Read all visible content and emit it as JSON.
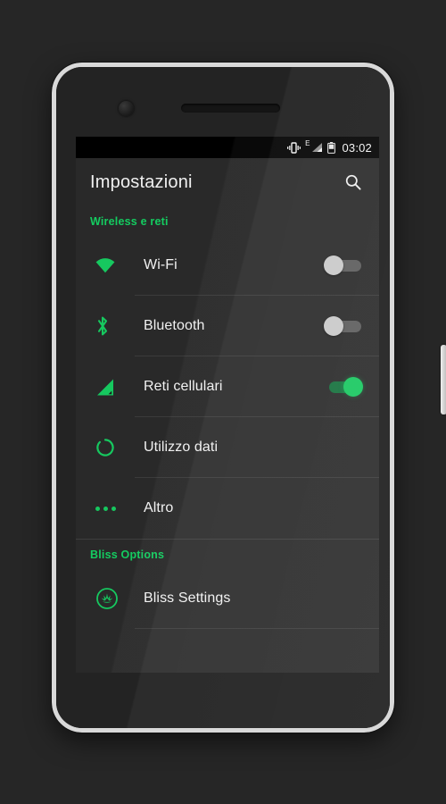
{
  "theme": {
    "accent_green": "#16c85f",
    "header_green": "#14cc60",
    "screen_bg": "#292929",
    "text_primary": "#f1f1f1",
    "bezel": "#d9d9d9"
  },
  "status_bar": {
    "vibrate_icon": "vibrate-icon",
    "network_type": "E",
    "signal_icon": "signal-bars-icon",
    "battery_icon": "battery-icon",
    "clock": "03:02"
  },
  "action_bar": {
    "title": "Impostazioni",
    "search_icon": "search-icon"
  },
  "sections": [
    {
      "header": "Wireless e reti",
      "rows": [
        {
          "label": "Wi-Fi",
          "icon": "wifi-icon",
          "toggle": "off"
        },
        {
          "label": "Bluetooth",
          "icon": "bluetooth-icon",
          "toggle": "off"
        },
        {
          "label": "Reti cellulari",
          "icon": "cell-signal-icon",
          "toggle": "on"
        },
        {
          "label": "Utilizzo dati",
          "icon": "data-usage-icon",
          "toggle": "none"
        },
        {
          "label": "Altro",
          "icon": "more-dots-icon",
          "toggle": "none"
        }
      ]
    },
    {
      "header": "Bliss Options",
      "rows": [
        {
          "label": "Bliss Settings",
          "icon": "bliss-logo-icon",
          "toggle": "none"
        }
      ]
    }
  ],
  "hardware": {
    "camera": "front-camera",
    "speaker": "earpiece-speaker",
    "volume_button": "volume-rocker",
    "power_button": "power-button"
  }
}
